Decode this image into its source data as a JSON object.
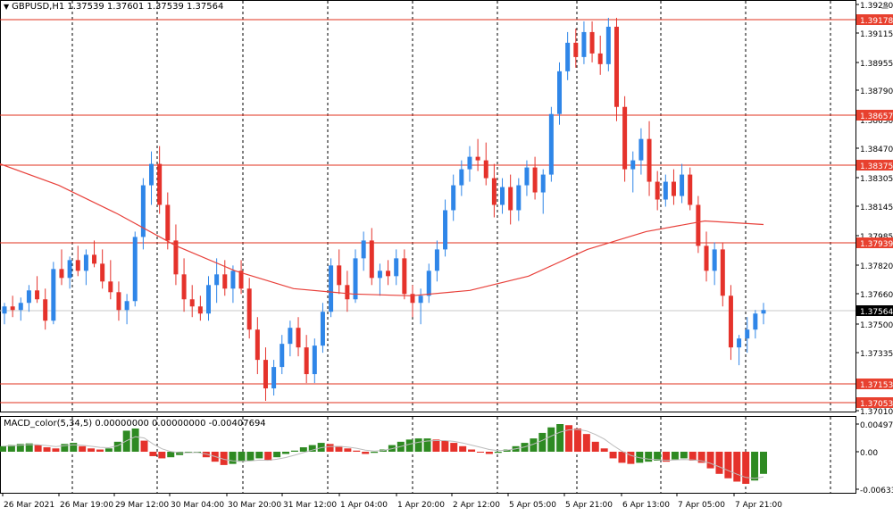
{
  "window": {
    "symbol_line": "GBPUSD,H1  1.37539 1.37601 1.37539 1.37564",
    "macd_line": "MACD_color(5,34,5) 0.00000000 0.00000000 -0.00407694"
  },
  "colors": {
    "bull": "#2f86e8",
    "bear": "#e5322b",
    "level_line": "#e0301e",
    "ma_line": "#e8403a",
    "macd_pos": "#2e8a22",
    "macd_neg": "#e5322b",
    "signal": "#bbbbbb",
    "grid": "#000000",
    "current_price_bg": "#000000"
  },
  "price_axis": {
    "ticks": [
      "1.39280",
      "1.39115",
      "1.38955",
      "1.38790",
      "1.38630",
      "1.38470",
      "1.38305",
      "1.38145",
      "1.37985",
      "1.37820",
      "1.37660",
      "1.37500",
      "1.37335",
      "1.37010"
    ],
    "current": "1.37564"
  },
  "levels": [
    {
      "label": "1.39178"
    },
    {
      "label": "1.38657"
    },
    {
      "label": "1.38375"
    },
    {
      "label": "1.37939"
    },
    {
      "label": "1.37153"
    },
    {
      "label": "1.37053"
    }
  ],
  "macd_axis": {
    "ticks": [
      "0.004972",
      "0.00",
      "-0.00633"
    ]
  },
  "time_axis": {
    "labels": [
      "26 Mar 2021",
      "26 Mar 19:00",
      "29 Mar 12:00",
      "30 Mar 04:00",
      "30 Mar 20:00",
      "31 Mar 12:00",
      "1 Apr 04:00",
      "1 Apr 20:00",
      "2 Apr 12:00",
      "5 Apr 05:00",
      "5 Apr 21:00",
      "6 Apr 13:00",
      "7 Apr 05:00",
      "7 Apr 21:00"
    ]
  },
  "chart_data": {
    "type": "candlestick",
    "ylim": [
      1.3701,
      1.3928
    ],
    "candles": [
      [
        1.3754,
        1.376,
        1.3748,
        1.3758
      ],
      [
        1.3758,
        1.3764,
        1.3752,
        1.3756
      ],
      [
        1.3756,
        1.3763,
        1.375,
        1.376
      ],
      [
        1.376,
        1.377,
        1.3755,
        1.3767
      ],
      [
        1.3767,
        1.3775,
        1.376,
        1.3762
      ],
      [
        1.3762,
        1.3768,
        1.3745,
        1.375
      ],
      [
        1.375,
        1.3783,
        1.3748,
        1.3779
      ],
      [
        1.3779,
        1.379,
        1.377,
        1.3774
      ],
      [
        1.3774,
        1.3786,
        1.3768,
        1.3784
      ],
      [
        1.3784,
        1.3792,
        1.3775,
        1.3778
      ],
      [
        1.3778,
        1.379,
        1.377,
        1.3787
      ],
      [
        1.3787,
        1.3795,
        1.378,
        1.3782
      ],
      [
        1.3782,
        1.379,
        1.3768,
        1.3772
      ],
      [
        1.3772,
        1.3784,
        1.3762,
        1.3766
      ],
      [
        1.3766,
        1.3772,
        1.375,
        1.3756
      ],
      [
        1.3756,
        1.3765,
        1.3748,
        1.3761
      ],
      [
        1.3761,
        1.38,
        1.3758,
        1.3797
      ],
      [
        1.3797,
        1.383,
        1.379,
        1.3826
      ],
      [
        1.3826,
        1.3845,
        1.3815,
        1.3838
      ],
      [
        1.3838,
        1.3848,
        1.381,
        1.3815
      ],
      [
        1.3815,
        1.3822,
        1.379,
        1.3795
      ],
      [
        1.3795,
        1.3804,
        1.377,
        1.3776
      ],
      [
        1.3776,
        1.3785,
        1.3755,
        1.3762
      ],
      [
        1.3762,
        1.377,
        1.3752,
        1.3758
      ],
      [
        1.3758,
        1.3764,
        1.375,
        1.3754
      ],
      [
        1.3754,
        1.3775,
        1.375,
        1.377
      ],
      [
        1.377,
        1.3785,
        1.376,
        1.3776
      ],
      [
        1.3776,
        1.3784,
        1.3764,
        1.3768
      ],
      [
        1.3768,
        1.3781,
        1.376,
        1.3778
      ],
      [
        1.3778,
        1.3784,
        1.3765,
        1.3768
      ],
      [
        1.3768,
        1.3774,
        1.374,
        1.3745
      ],
      [
        1.3745,
        1.3752,
        1.372,
        1.3728
      ],
      [
        1.3728,
        1.3735,
        1.3705,
        1.3712
      ],
      [
        1.3712,
        1.3728,
        1.3708,
        1.3724
      ],
      [
        1.3724,
        1.3742,
        1.372,
        1.3737
      ],
      [
        1.3737,
        1.375,
        1.373,
        1.3746
      ],
      [
        1.3746,
        1.3752,
        1.373,
        1.3735
      ],
      [
        1.3735,
        1.3742,
        1.3715,
        1.372
      ],
      [
        1.372,
        1.374,
        1.3715,
        1.3736
      ],
      [
        1.3736,
        1.376,
        1.3732,
        1.3755
      ],
      [
        1.3755,
        1.3785,
        1.3752,
        1.3781
      ],
      [
        1.3781,
        1.379,
        1.3765,
        1.377
      ],
      [
        1.377,
        1.3778,
        1.3755,
        1.3762
      ],
      [
        1.3762,
        1.379,
        1.376,
        1.3785
      ],
      [
        1.3785,
        1.38,
        1.3778,
        1.3795
      ],
      [
        1.3795,
        1.3802,
        1.377,
        1.3774
      ],
      [
        1.3774,
        1.3782,
        1.3764,
        1.3778
      ],
      [
        1.3778,
        1.3784,
        1.377,
        1.3775
      ],
      [
        1.3775,
        1.379,
        1.377,
        1.3785
      ],
      [
        1.3785,
        1.379,
        1.3762,
        1.3765
      ],
      [
        1.3765,
        1.377,
        1.3752,
        1.376
      ],
      [
        1.376,
        1.3768,
        1.3748,
        1.3764
      ],
      [
        1.3764,
        1.3782,
        1.376,
        1.3778
      ],
      [
        1.3778,
        1.3795,
        1.3772,
        1.379
      ],
      [
        1.379,
        1.3818,
        1.3786,
        1.3812
      ],
      [
        1.3812,
        1.3832,
        1.3806,
        1.3826
      ],
      [
        1.3826,
        1.384,
        1.382,
        1.3835
      ],
      [
        1.3835,
        1.3848,
        1.3828,
        1.3842
      ],
      [
        1.3842,
        1.3852,
        1.3834,
        1.384
      ],
      [
        1.384,
        1.385,
        1.3826,
        1.383
      ],
      [
        1.383,
        1.3838,
        1.3808,
        1.3815
      ],
      [
        1.3815,
        1.383,
        1.381,
        1.3825
      ],
      [
        1.3825,
        1.3832,
        1.3804,
        1.3812
      ],
      [
        1.3812,
        1.383,
        1.3806,
        1.3826
      ],
      [
        1.3826,
        1.384,
        1.382,
        1.3836
      ],
      [
        1.3836,
        1.3842,
        1.3818,
        1.3822
      ],
      [
        1.3822,
        1.3835,
        1.381,
        1.3832
      ],
      [
        1.3832,
        1.387,
        1.3828,
        1.3866
      ],
      [
        1.3866,
        1.3895,
        1.386,
        1.389
      ],
      [
        1.389,
        1.3912,
        1.3885,
        1.3906
      ],
      [
        1.3906,
        1.3914,
        1.3892,
        1.3898
      ],
      [
        1.3898,
        1.3918,
        1.3894,
        1.3912
      ],
      [
        1.3912,
        1.3918,
        1.3895,
        1.39
      ],
      [
        1.39,
        1.391,
        1.3888,
        1.3894
      ],
      [
        1.3894,
        1.392,
        1.389,
        1.3915
      ],
      [
        1.3915,
        1.392,
        1.3862,
        1.387
      ],
      [
        1.387,
        1.3876,
        1.3828,
        1.3835
      ],
      [
        1.3835,
        1.3845,
        1.3822,
        1.384
      ],
      [
        1.384,
        1.3858,
        1.3832,
        1.3852
      ],
      [
        1.3852,
        1.3862,
        1.382,
        1.3828
      ],
      [
        1.3828,
        1.3834,
        1.3812,
        1.3818
      ],
      [
        1.3818,
        1.3832,
        1.3814,
        1.3828
      ],
      [
        1.3828,
        1.3835,
        1.3815,
        1.382
      ],
      [
        1.382,
        1.3838,
        1.3816,
        1.3832
      ],
      [
        1.3832,
        1.3836,
        1.3812,
        1.3815
      ],
      [
        1.3815,
        1.382,
        1.3788,
        1.3792
      ],
      [
        1.3792,
        1.38,
        1.3772,
        1.3778
      ],
      [
        1.3778,
        1.3794,
        1.377,
        1.379
      ],
      [
        1.379,
        1.3794,
        1.3758,
        1.3764
      ],
      [
        1.3764,
        1.377,
        1.3728,
        1.3735
      ],
      [
        1.3735,
        1.3742,
        1.3725,
        1.374
      ],
      [
        1.374,
        1.3752,
        1.3732,
        1.3745
      ],
      [
        1.3745,
        1.3756,
        1.374,
        1.3754
      ],
      [
        1.3754,
        1.376,
        1.3748,
        1.3756
      ]
    ],
    "ma200": [
      1.3838,
      1.3826,
      1.381,
      1.3792,
      1.3778,
      1.3768,
      1.3765,
      1.3764,
      1.3767,
      1.3775,
      1.379,
      1.38,
      1.3806,
      1.3804
    ],
    "macd": [
      0.001,
      0.0012,
      0.0014,
      0.0015,
      0.0012,
      0.0008,
      0.0006,
      0.0014,
      0.0016,
      0.001,
      0.0006,
      0.0004,
      0.0006,
      0.0018,
      0.0038,
      0.0042,
      0.002,
      -0.0008,
      -0.0012,
      -0.001,
      -0.0006,
      -0.0002,
      0.0,
      -0.001,
      -0.0018,
      -0.0024,
      -0.0022,
      -0.0018,
      -0.0016,
      -0.0012,
      -0.0016,
      -0.001,
      -0.0004,
      0.0002,
      0.0008,
      0.0012,
      0.0016,
      0.0014,
      0.001,
      0.0006,
      0.0002,
      -0.0004,
      -0.0002,
      0.0004,
      0.0012,
      0.0018,
      0.0022,
      0.0024,
      0.0024,
      0.0022,
      0.002,
      0.0016,
      0.001,
      0.0004,
      0.0,
      -0.0004,
      -0.0002,
      0.0004,
      0.001,
      0.0016,
      0.0024,
      0.0034,
      0.0044,
      0.005,
      0.0048,
      0.0042,
      0.0032,
      0.0018,
      0.0006,
      -0.0012,
      -0.002,
      -0.0022,
      -0.002,
      -0.0018,
      -0.0016,
      -0.0018,
      -0.0014,
      -0.0012,
      -0.0016,
      -0.002,
      -0.003,
      -0.004,
      -0.0048,
      -0.0054,
      -0.0058,
      -0.0052,
      -0.004
    ]
  }
}
